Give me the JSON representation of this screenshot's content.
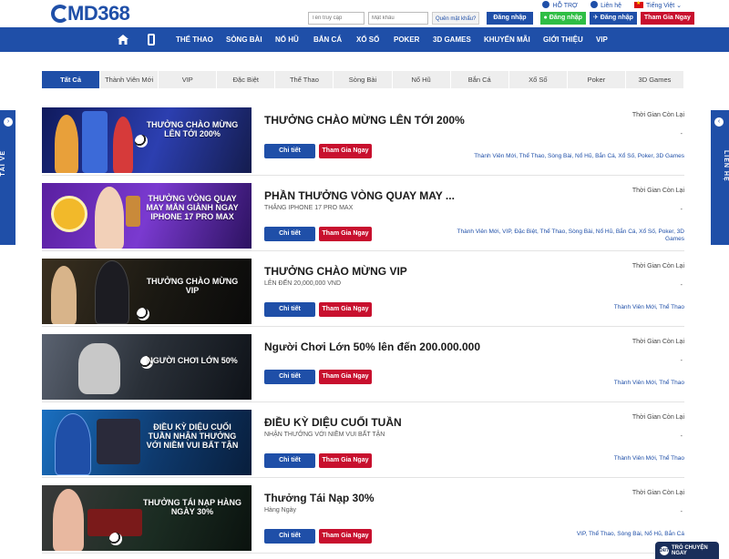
{
  "brand": {
    "logo_text": "MD368"
  },
  "top_links": {
    "support": "HỖ TRỢ",
    "contact": "Liên hệ",
    "language": "Tiếng Việt"
  },
  "login": {
    "username_placeholder": "Tên truy cập",
    "password_placeholder": "Mật khẩu",
    "forgot": "Quên mật khẩu?",
    "login_button": "Đăng nhập",
    "line_login": "Đăng nhập",
    "telegram_login": "Đăng nhập",
    "join_button": "Tham Gia Ngay"
  },
  "nav": {
    "items": [
      "THỂ THAO",
      "SÒNG BÀI",
      "NỔ HŨ",
      "BẮN CÁ",
      "XỔ SỐ",
      "POKER",
      "3D GAMES",
      "KHUYẾN MÃI",
      "GIỚI THIỆU",
      "VIP"
    ]
  },
  "tabs": [
    "Tất Cả",
    "Thành Viên Mới",
    "VIP",
    "Đặc Biệt",
    "Thể Thao",
    "Sòng Bài",
    "Nổ Hũ",
    "Bắn Cá",
    "Xổ Số",
    "Poker",
    "3D Games"
  ],
  "side": {
    "left": "TẢI VỀ",
    "right": "LIÊN HỆ"
  },
  "promo_labels": {
    "time_left": "Thời Gian Còn Lại",
    "dash": "-",
    "detail": "Chi tiết",
    "join": "Tham Gia Ngay"
  },
  "promotions": [
    {
      "title": "THƯỞNG CHÀO MỪNG LÊN TỚI 200%",
      "subtitle": "",
      "banner_text": "THƯỞNG CHÀO MỪNG LÊN TỚI 200%",
      "categories": "Thành Viên Mới, Thể Thao, Sòng Bài, Nổ Hũ, Bắn Cá, Xổ Số, Poker, 3D Games",
      "banner_color": "#1b2a7a"
    },
    {
      "title": "PHẦN THƯỞNG VÒNG QUAY MAY ...",
      "subtitle": "THẮNG IPHONE 17 PRO MAX",
      "banner_text": "THƯỞNG VÒNG QUAY MAY MẮN GIÀNH NGAY IPHONE 17 PRO MAX",
      "categories": "Thành Viên Mới, VIP, Đặc Biệt, Thể Thao, Sòng Bài, Nổ Hũ, Bắn Cá, Xổ Số, Poker, 3D Games",
      "banner_color": "#4a1f8c"
    },
    {
      "title": "THƯỞNG CHÀO MỪNG VIP",
      "subtitle": "LÊN ĐẾN 20,000,000 VND",
      "banner_text": "THƯỞNG CHÀO MỪNG VIP",
      "categories": "Thành Viên Mới, Thể Thao",
      "banner_color": "#2a2418"
    },
    {
      "title": "Người Chơi Lớn 50% lên đến 200.000.000",
      "subtitle": "",
      "banner_text": "NGƯỜI CHƠI LỚN 50%",
      "categories": "Thành Viên Mới, Thể Thao",
      "banner_color": "#1e2430"
    },
    {
      "title": "ĐIỀU KỲ DIỆU CUỐI TUẦN",
      "subtitle": "NHẬN THƯỞNG VỚI NIỀM VUI BẤT TẬN",
      "banner_text": "ĐIỀU KỲ DIỆU CUỐI TUẦN NHẬN THƯỞNG VỚI NIỀM VUI BẤT TẬN",
      "categories": "Thành Viên Mới, Thể Thao",
      "banner_color": "#0e3a6e"
    },
    {
      "title": "Thưởng Tái Nạp 30%",
      "subtitle": "Hàng Ngày",
      "banner_text": "THƯỞNG TÁI NẠP HÀNG NGÀY 30%",
      "categories": "VIP, Thể Thao, Sòng Bài, Nổ Hũ, Bắn Cá",
      "banner_color": "#1b2c22"
    }
  ],
  "chat": {
    "label": "TRÒ CHUYỆN NGAY",
    "badge": "24/7"
  }
}
